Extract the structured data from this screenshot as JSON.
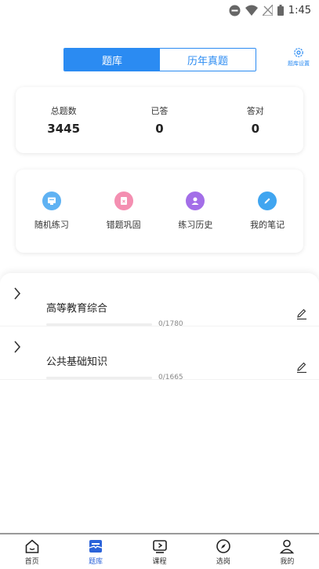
{
  "status_bar": {
    "time": "1:45"
  },
  "tabs": [
    {
      "label": "题库",
      "active": true
    },
    {
      "label": "历年真题",
      "active": false
    }
  ],
  "settings": {
    "label": "题库设置",
    "icon": "gear-icon"
  },
  "stats": [
    {
      "label": "总题数",
      "value": "3445"
    },
    {
      "label": "已答",
      "value": "0"
    },
    {
      "label": "答对",
      "value": "0"
    }
  ],
  "actions": [
    {
      "label": "随机练习",
      "icon": "random-practice-icon",
      "color": "#5fb2f3"
    },
    {
      "label": "错题巩固",
      "icon": "wrong-questions-icon",
      "color": "#f48fb1"
    },
    {
      "label": "练习历史",
      "icon": "history-icon",
      "color": "#a36ee8"
    },
    {
      "label": "我的笔记",
      "icon": "notes-icon",
      "color": "#40a5f0"
    }
  ],
  "subjects": [
    {
      "name": "高等教育综合",
      "progress": "0/1780",
      "progress_fraction": 0
    },
    {
      "name": "公共基础知识",
      "progress": "0/1665",
      "progress_fraction": 0
    }
  ],
  "bottom_nav": [
    {
      "label": "首页",
      "icon": "home-icon",
      "active": false
    },
    {
      "label": "题库",
      "icon": "question-bank-icon",
      "active": true
    },
    {
      "label": "课程",
      "icon": "course-icon",
      "active": false
    },
    {
      "label": "选岗",
      "icon": "compass-icon",
      "active": false
    },
    {
      "label": "我的",
      "icon": "profile-icon",
      "active": false
    }
  ],
  "colors": {
    "accent": "#2b8bf2",
    "nav_active": "#2b63d9"
  }
}
